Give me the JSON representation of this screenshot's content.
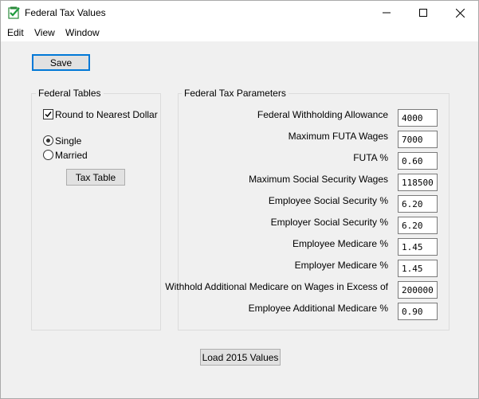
{
  "window": {
    "title": "Federal Tax Values"
  },
  "titlebar_controls": {
    "minimize": "—",
    "maximize": "☐",
    "close": "✕"
  },
  "menu": [
    "Edit",
    "View",
    "Window"
  ],
  "toolbar": {
    "save_label": "Save"
  },
  "federal_tables": {
    "legend": "Federal Tables",
    "round_label": "Round to Nearest Dollar",
    "round_checked": true,
    "status_options": [
      "Single",
      "Married"
    ],
    "selected_status": "Single",
    "tax_table_label": "Tax Table"
  },
  "parameters": {
    "legend": "Federal Tax Parameters",
    "items": [
      {
        "label": "Federal Withholding Allowance",
        "value": "4000"
      },
      {
        "label": "Maximum FUTA Wages",
        "value": "7000"
      },
      {
        "label": "FUTA %",
        "value": "0.60"
      },
      {
        "label": "Maximum Social Security Wages",
        "value": "118500"
      },
      {
        "label": "Employee Social Security %",
        "value": "6.20"
      },
      {
        "label": "Employer Social Security %",
        "value": "6.20"
      },
      {
        "label": "Employee Medicare %",
        "value": "1.45"
      },
      {
        "label": "Employer Medicare %",
        "value": "1.45"
      },
      {
        "label": "Withhold Additional Medicare on Wages in Excess of",
        "value": "200000"
      },
      {
        "label": "Employee Additional Medicare %",
        "value": "0.90"
      }
    ]
  },
  "footer": {
    "load_label": "Load 2015 Values"
  },
  "colors": {
    "focus_border": "#0078d7",
    "button_face": "#e1e1e1",
    "window_bg": "#f0f0f0"
  }
}
